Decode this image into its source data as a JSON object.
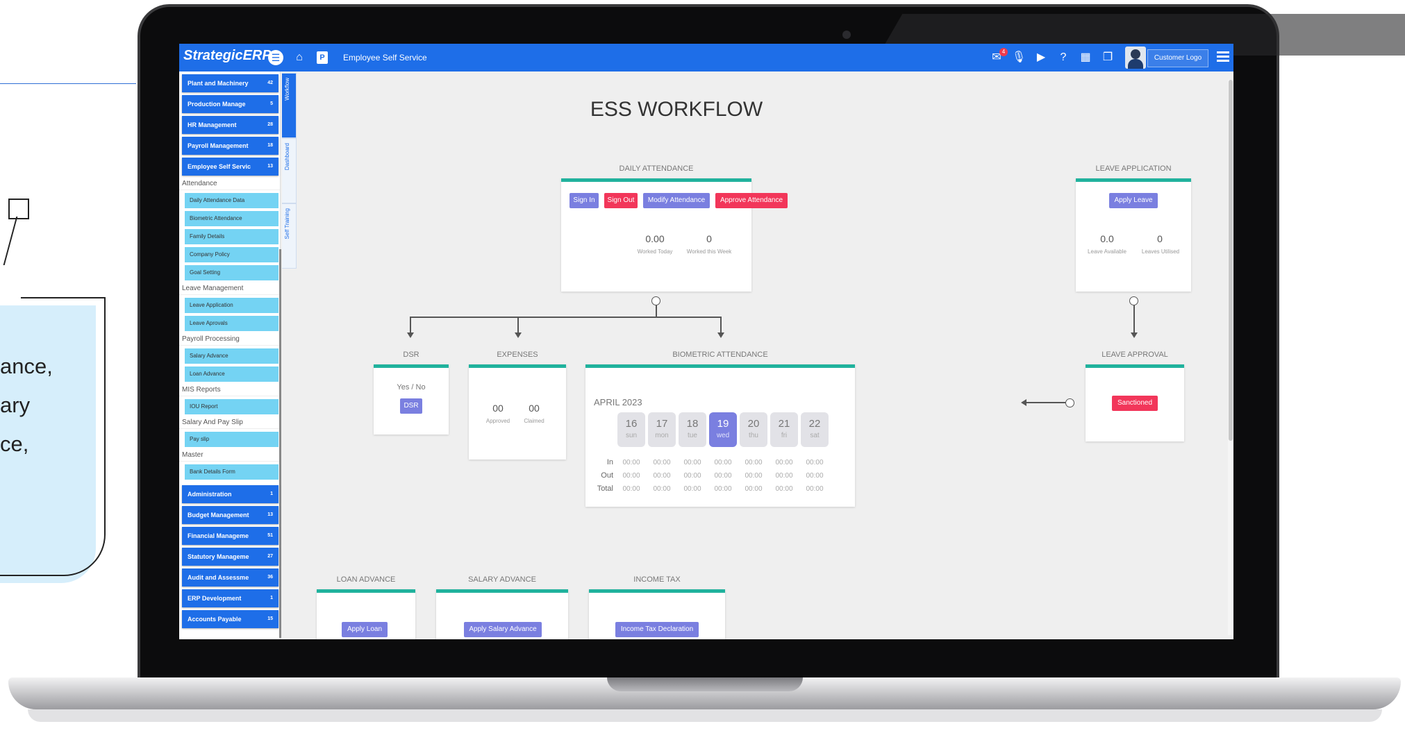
{
  "callout": {
    "lines": [
      "ance,",
      "ary",
      "ce,"
    ]
  },
  "topbar": {
    "brand": "StrategicERP",
    "page_name": "Employee Self Service",
    "p_badge": "P",
    "mail_count": "4",
    "customer_logo": "Customer Logo",
    "icons": [
      "menu-icon",
      "home-icon",
      "mail-icon",
      "mic-icon",
      "video-icon",
      "help-icon",
      "calculator-icon",
      "copy-icon",
      "grid-menu-icon"
    ]
  },
  "sidebar": {
    "modules_top": [
      {
        "label": "Plant and Machinery",
        "count": "42"
      },
      {
        "label": "Production Manage",
        "count": "5"
      },
      {
        "label": "HR Management",
        "count": "28"
      },
      {
        "label": "Payroll Management",
        "count": "18"
      },
      {
        "label": "Employee Self Servic",
        "count": "13"
      }
    ],
    "sections": [
      {
        "title": "Attendance",
        "items": [
          "Daily Attendance Data",
          "Biometric Attendance",
          "Family Details",
          "Company Policy",
          "Goal Setting"
        ]
      },
      {
        "title": "Leave Management",
        "items": [
          "Leave Application",
          "Leave Aprovals"
        ]
      },
      {
        "title": "Payroll Processing",
        "items": [
          "Salary Advance",
          "Loan Advance"
        ]
      },
      {
        "title": "MIS Reports",
        "items": [
          "IOU Report"
        ]
      },
      {
        "title": "Salary And Pay Slip",
        "items": [
          "Pay slip"
        ]
      },
      {
        "title": "Master",
        "items": [
          "Bank Details Form"
        ]
      }
    ],
    "modules_bottom": [
      {
        "label": "Administration",
        "count": "1"
      },
      {
        "label": "Budget Management",
        "count": "13"
      },
      {
        "label": "Financial Manageme",
        "count": "51"
      },
      {
        "label": "Statutory Manageme",
        "count": "27"
      },
      {
        "label": "Audit and Assessme",
        "count": "36"
      },
      {
        "label": "ERP Development",
        "count": "1"
      },
      {
        "label": "Accounts Payable",
        "count": "15"
      }
    ],
    "tabs": [
      "Workflow",
      "Dashboard",
      "Self Training"
    ]
  },
  "main": {
    "title": "ESS WORKFLOW",
    "daily_attendance": {
      "label": "DAILY ATTENDANCE",
      "buttons": [
        "Sign In",
        "Sign Out",
        "Modify Attendance",
        "Approve Attendance"
      ],
      "worked_today": "0.00",
      "worked_today_cap": "Worked Today",
      "worked_week": "0",
      "worked_week_cap": "Worked this Week"
    },
    "leave_application": {
      "label": "LEAVE APPLICATION",
      "button": "Apply Leave",
      "available": "0.0",
      "available_cap": "Leave Available",
      "utilised": "0",
      "utilised_cap": "Leaves Utilised"
    },
    "dsr": {
      "label": "DSR",
      "text": "Yes / No",
      "button": "DSR"
    },
    "expenses": {
      "label": "EXPENSES",
      "approved": "00",
      "approved_cap": "Approved",
      "claimed": "00",
      "claimed_cap": "Claimed"
    },
    "biometric": {
      "label": "BIOMETRIC ATTENDANCE",
      "month": "APRIL 2023",
      "days": [
        {
          "d": "16",
          "w": "sun"
        },
        {
          "d": "17",
          "w": "mon"
        },
        {
          "d": "18",
          "w": "tue"
        },
        {
          "d": "19",
          "w": "wed"
        },
        {
          "d": "20",
          "w": "thu"
        },
        {
          "d": "21",
          "w": "fri"
        },
        {
          "d": "22",
          "w": "sat"
        }
      ],
      "selected_day": "19",
      "rows": [
        {
          "label": "In",
          "values": [
            "00:00",
            "00:00",
            "00:00",
            "00:00",
            "00:00",
            "00:00",
            "00:00"
          ]
        },
        {
          "label": "Out",
          "values": [
            "00:00",
            "00:00",
            "00:00",
            "00:00",
            "00:00",
            "00:00",
            "00:00"
          ]
        },
        {
          "label": "Total",
          "values": [
            "00:00",
            "00:00",
            "00:00",
            "00:00",
            "00:00",
            "00:00",
            "00:00"
          ]
        }
      ]
    },
    "leave_approval": {
      "label": "LEAVE APPROVAL",
      "button": "Sanctioned"
    },
    "loan_advance": {
      "label": "LOAN ADVANCE",
      "button": "Apply Loan"
    },
    "salary_advance": {
      "label": "SALARY ADVANCE",
      "button": "Apply Salary Advance"
    },
    "income_tax": {
      "label": "INCOME TAX",
      "button": "Income Tax Declaration"
    }
  },
  "colors": {
    "accent": "#1e6ee8",
    "teal": "#20b29d",
    "purple": "#7a7fe0",
    "red": "#f2365a",
    "cyan": "#74d3f3"
  }
}
